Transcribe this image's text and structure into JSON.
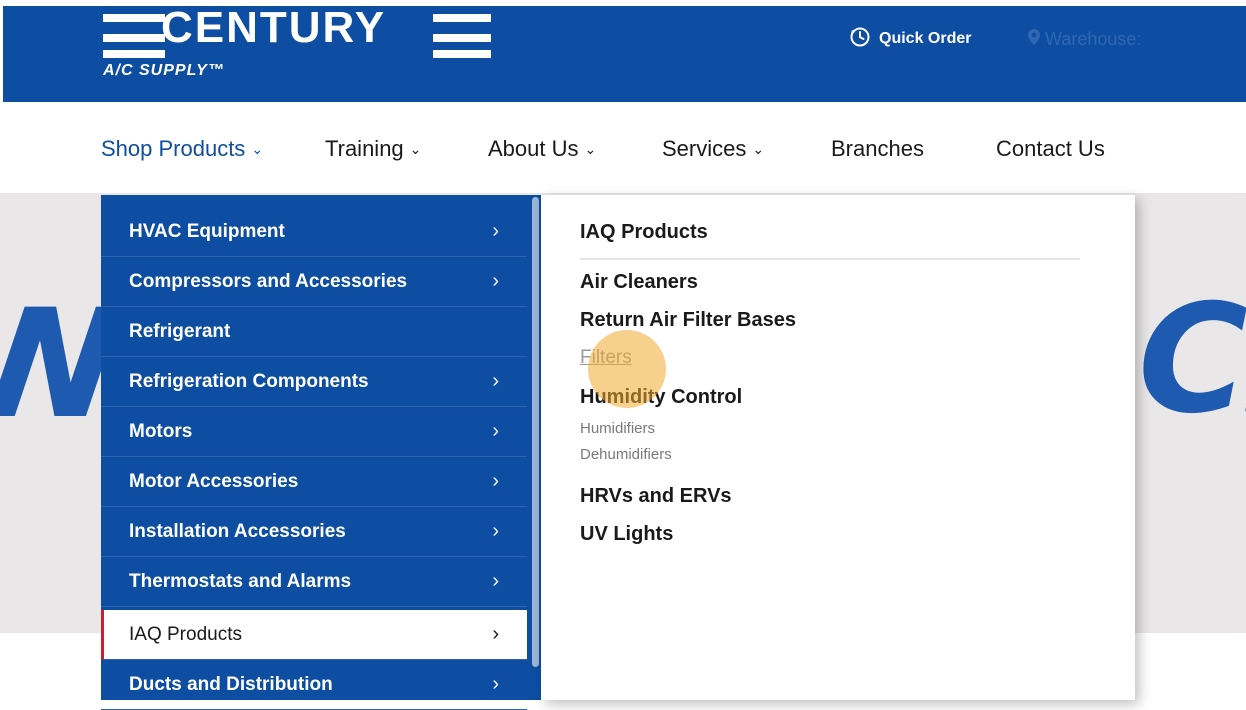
{
  "header": {
    "logo_word": "CENTURY",
    "logo_sub": "A/C SUPPLY™",
    "quick_order_label": "Quick Order",
    "warehouse_label": "Warehouse:"
  },
  "nav": {
    "items": [
      {
        "label": "Shop Products",
        "has_chevron": true,
        "active": true
      },
      {
        "label": "Training",
        "has_chevron": true
      },
      {
        "label": "About Us",
        "has_chevron": true
      },
      {
        "label": "Services",
        "has_chevron": true
      },
      {
        "label": "Branches"
      },
      {
        "label": "Contact Us"
      }
    ],
    "chevron_glyph": "⌄"
  },
  "hero": {
    "left_fragment": "N",
    "right_fragment": "CL"
  },
  "menu": {
    "arrow_glyph": "›",
    "categories": [
      {
        "label": "HVAC Equipment",
        "arrow": true
      },
      {
        "label": "Compressors and Accessories",
        "arrow": true
      },
      {
        "label": "Refrigerant",
        "arrow": false
      },
      {
        "label": "Refrigeration Components",
        "arrow": true
      },
      {
        "label": "Motors",
        "arrow": true
      },
      {
        "label": "Motor Accessories",
        "arrow": true
      },
      {
        "label": "Installation Accessories",
        "arrow": true
      },
      {
        "label": "Thermostats and Alarms",
        "arrow": true
      },
      {
        "label": "IAQ Products",
        "arrow": true,
        "selected": true
      },
      {
        "label": "Ducts and Distribution",
        "arrow": true
      }
    ],
    "submenu": {
      "title": "IAQ Products",
      "items": [
        {
          "label": "Air Cleaners",
          "type": "heading"
        },
        {
          "label": "Return Air Filter Bases",
          "type": "heading"
        },
        {
          "label": "Filters",
          "type": "hovered"
        },
        {
          "label": "Humidity Control",
          "type": "heading"
        },
        {
          "label": "Humidifiers",
          "type": "minor"
        },
        {
          "label": "Dehumidifiers",
          "type": "minor"
        },
        {
          "label": "HRVs and ERVs",
          "type": "heading"
        },
        {
          "label": "UV Lights",
          "type": "heading"
        }
      ]
    }
  },
  "colors": {
    "brand_blue": "#0d4ea2",
    "selected_accent": "#c8202f",
    "cursor_highlight": "#f3aa32"
  },
  "icons": {
    "quick_order": "history-clock-icon",
    "warehouse": "map-pin-icon"
  }
}
